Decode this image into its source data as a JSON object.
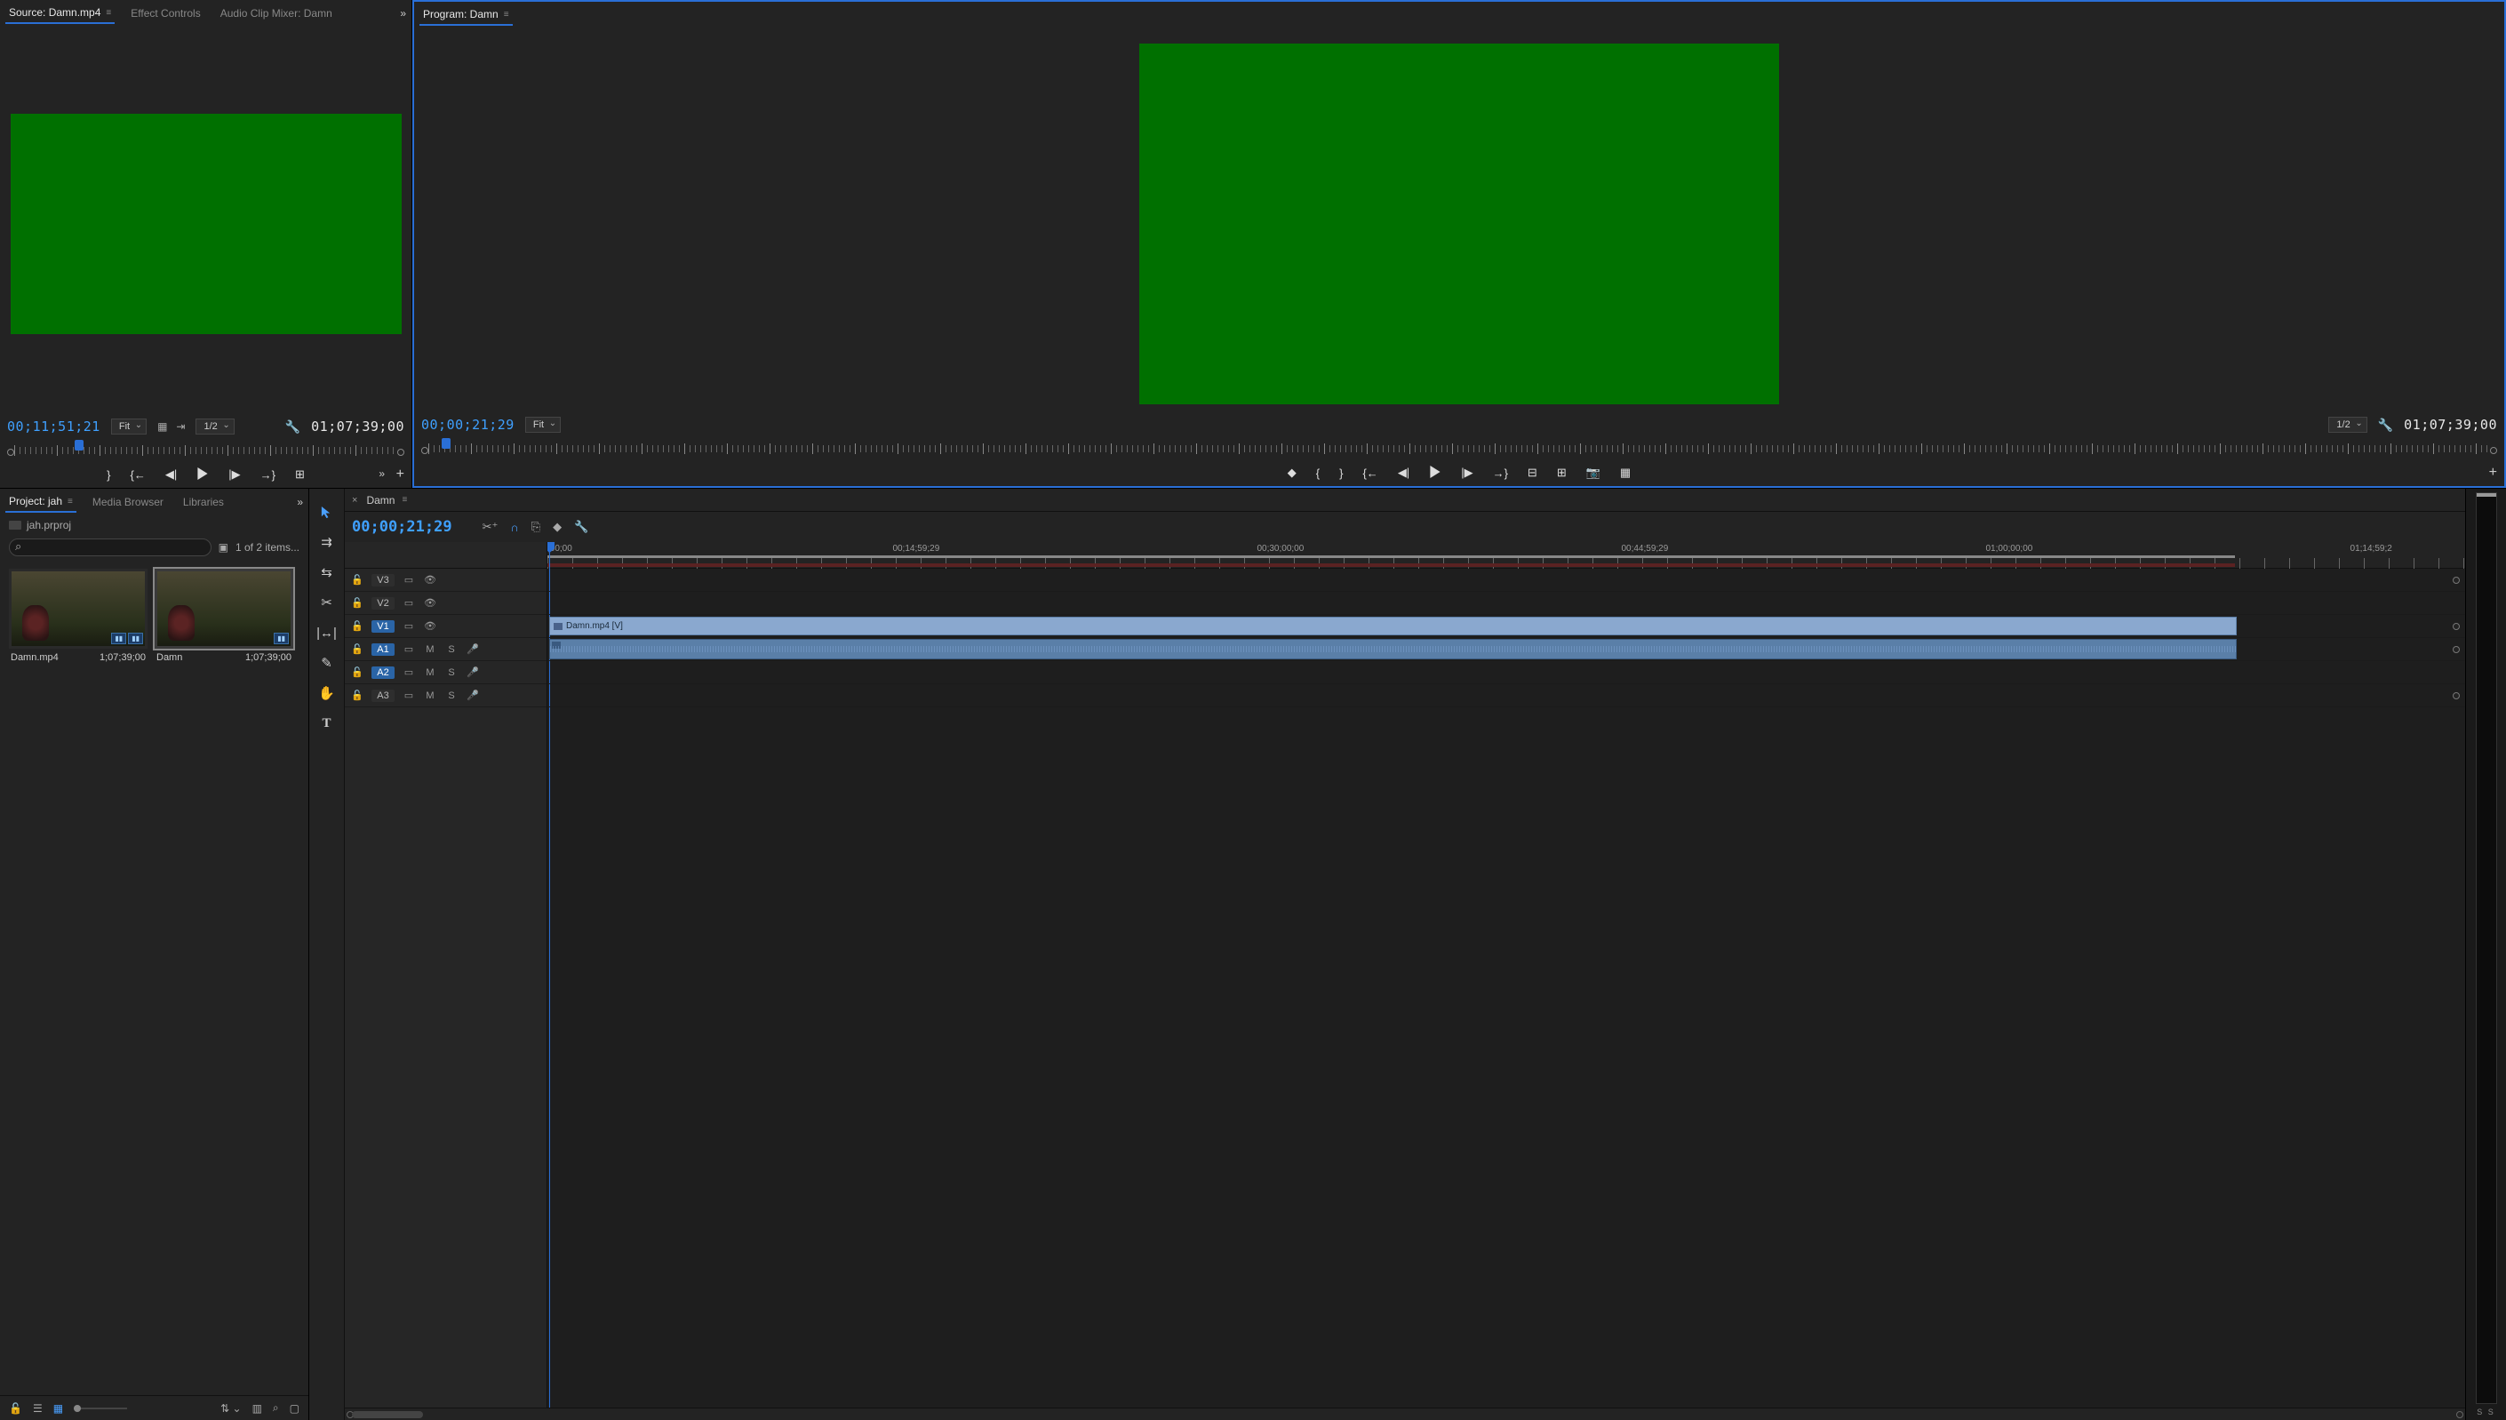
{
  "source": {
    "tabs": [
      "Source: Damn.mp4",
      "Effect Controls",
      "Audio Clip Mixer: Damn"
    ],
    "active_tab": 0,
    "timecode": "00;11;51;21",
    "fit": "Fit",
    "res": "1/2",
    "duration": "01;07;39;00",
    "scrub_head_pct": 17
  },
  "program": {
    "tab": "Program: Damn",
    "timecode": "00;00;21;29",
    "fit": "Fit",
    "res": "1/2",
    "duration": "01;07;39;00",
    "scrub_head_pct": 1
  },
  "project": {
    "tabs": [
      "Project: jah",
      "Media Browser",
      "Libraries"
    ],
    "active_tab": 0,
    "file": "jah.prproj",
    "search_placeholder": "",
    "item_count": "1 of 2 items...",
    "items": [
      {
        "name": "Damn.mp4",
        "duration": "1;07;39;00",
        "selected": false,
        "badges": [
          "▮▮",
          "▮▮"
        ]
      },
      {
        "name": "Damn",
        "duration": "1;07;39;00",
        "selected": true,
        "badges": [
          "▮▮"
        ]
      }
    ]
  },
  "sequence": {
    "tab": "Damn",
    "timecode": "00;00;21;29",
    "ruler": [
      ";00;00",
      "00;14;59;29",
      "00;30;00;00",
      "00;44;59;29",
      "01;00;00;00",
      "01;14;59;2"
    ],
    "video_tracks": [
      {
        "label": "V3",
        "enabled": false
      },
      {
        "label": "V2",
        "enabled": false
      },
      {
        "label": "V1",
        "enabled": true
      }
    ],
    "audio_tracks": [
      {
        "label": "A1",
        "enabled": true
      },
      {
        "label": "A2",
        "enabled": true
      },
      {
        "label": "A3",
        "enabled": false
      }
    ],
    "clip_name": "Damn.mp4 [V]"
  },
  "meters": {
    "label": "S  S"
  },
  "icons": {
    "menu": "≡",
    "chevrons": "»",
    "wrench": "🔧",
    "plus": "+",
    "mark": "{",
    "mark2": "}",
    "goin": "⇤",
    "step_b": "◀|",
    "play": "▶",
    "step_f": "|▶",
    "goout": "⇥",
    "insert": "⎘",
    "overwrite": "⎗",
    "lift": "⬚",
    "extract": "⬓",
    "snapshot": "📷",
    "compare": "▦",
    "marker": "◆",
    "lock": "🔓",
    "sync": "▭",
    "eye": "👁",
    "mute": "M",
    "solo": "S",
    "rec": "●",
    "snap": "�magnet",
    "link": "∞",
    "marker2": "◆",
    "wrench2": "🔧",
    "razor": "✂",
    "ripple": "⇆",
    "pen": "✎",
    "hand": "✋",
    "text": "T"
  }
}
